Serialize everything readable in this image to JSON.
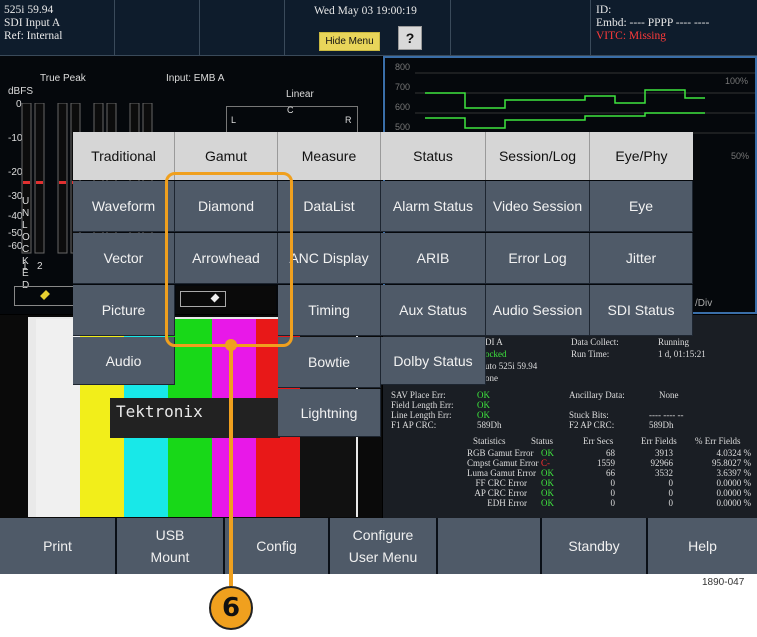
{
  "topbar": {
    "format": "525i 59.94",
    "input": "SDI Input A",
    "ref": "Ref: Internal",
    "datetime": "Wed May 03 19:00:19",
    "hide_menu": "Hide Menu",
    "help_q": "?",
    "id_label": "ID:",
    "embd": "Embd: ---- PPPP ---- ----",
    "vitc": "VITC: Missing"
  },
  "audio": {
    "true_peak": "True Peak",
    "input": "Input: EMB A",
    "dbfs": "dBFS",
    "linear": "Linear",
    "scale": [
      "0",
      "-10",
      "-20",
      "-30",
      "-40",
      "-50",
      "-60"
    ],
    "unlocked": "UNLOCKED",
    "ch_labels": [
      "1",
      "2"
    ],
    "lcr": [
      "L",
      "C",
      "R"
    ]
  },
  "waveform": {
    "scale": [
      "800",
      "700",
      "600",
      "500"
    ],
    "pct": [
      "100%",
      "50%"
    ],
    "div": "/Div"
  },
  "picture": {
    "brand": "Tektronix"
  },
  "status": {
    "sdi": "DI A",
    "locked": "ocked",
    "auto": "uto 525i 59.94",
    "none1": "one",
    "data_collect_label": "Data Collect:",
    "data_collect_value": "Running",
    "run_time_label": "Run Time:",
    "run_time_value": "1 d, 01:15:21",
    "rows_left": [
      {
        "label": "SAV Place Err:",
        "value": "OK"
      },
      {
        "label": "Field Length Err:",
        "value": "OK"
      },
      {
        "label": "Line Length Err:",
        "value": "OK"
      },
      {
        "label": "F1 AP CRC:",
        "value": "589Dh"
      }
    ],
    "anc_label": "Ancillary Data:",
    "anc_value": "None",
    "stuck_label": "Stuck Bits:",
    "stuck_value": "---- ---- --",
    "f2_label": "F2 AP CRC:",
    "f2_value": "589Dh",
    "table_headers": [
      "Statistics",
      "Status",
      "Err Secs",
      "Err Fields",
      "% Err Fields"
    ],
    "table_rows": [
      {
        "name": "RGB Gamut Error",
        "status": "OK",
        "secs": "68",
        "fields": "3913",
        "pct": "4.0324 %"
      },
      {
        "name": "Cmpst Gamut Error",
        "status": "C-",
        "secs": "1559",
        "fields": "92966",
        "pct": "95.8027 %"
      },
      {
        "name": "Luma Gamut Error",
        "status": "OK",
        "secs": "66",
        "fields": "3532",
        "pct": "3.6397 %"
      },
      {
        "name": "FF CRC Error",
        "status": "OK",
        "secs": "0",
        "fields": "0",
        "pct": "0.0000 %"
      },
      {
        "name": "AP CRC Error",
        "status": "OK",
        "secs": "0",
        "fields": "0",
        "pct": "0.0000 %"
      },
      {
        "name": "EDH Error",
        "status": "OK",
        "secs": "0",
        "fields": "0",
        "pct": "0.0000 %"
      }
    ]
  },
  "menu": {
    "headers": [
      "Traditional",
      "Gamut",
      "Measure",
      "Status",
      "Session/Log",
      "Eye/Phy"
    ],
    "col1": [
      "Waveform",
      "Vector",
      "Picture",
      "Audio"
    ],
    "col2": [
      "Diamond",
      "Arrowhead"
    ],
    "col3": [
      "DataList",
      "ANC Display",
      "Timing",
      "Bowtie",
      "Lightning"
    ],
    "col4": [
      "Alarm Status",
      "ARIB",
      "Aux Status",
      "Dolby Status"
    ],
    "col5": [
      "Video Session",
      "Error Log",
      "Audio Session"
    ],
    "col6": [
      "Eye",
      "Jitter",
      "SDI Status"
    ]
  },
  "bottom": {
    "print": "Print",
    "usb1": "USB",
    "usb2": "Mount",
    "config": "Config",
    "configure1": "Configure",
    "configure2": "User Menu",
    "standby": "Standby",
    "help": "Help"
  },
  "callout": {
    "number": "6",
    "figure_id": "1890-047",
    "color": "#f0a01e"
  }
}
